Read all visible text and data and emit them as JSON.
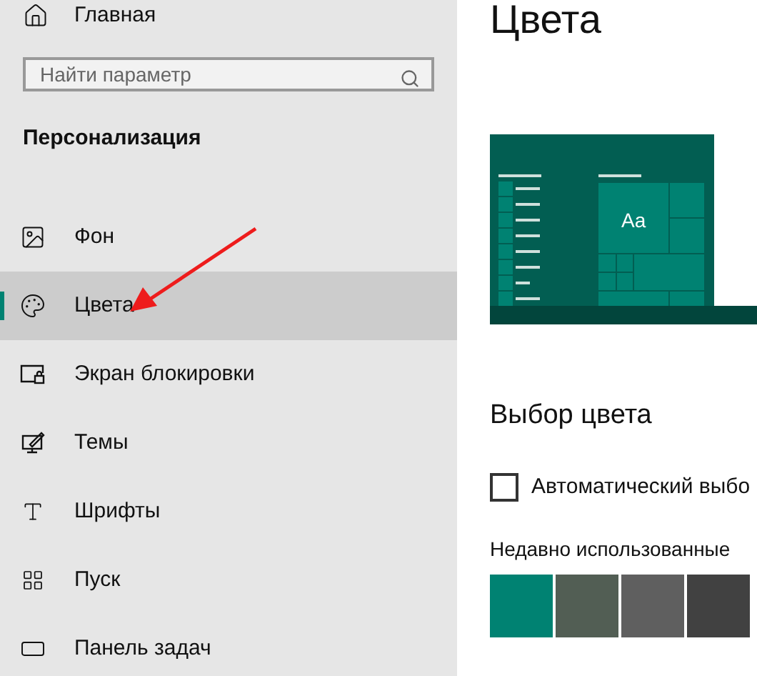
{
  "sidebar": {
    "home": "Главная",
    "search": {
      "placeholder": "Найти параметр"
    },
    "section": "Персонализация",
    "items": [
      {
        "label": "Фон",
        "selected": false
      },
      {
        "label": "Цвета",
        "selected": true
      },
      {
        "label": "Экран блокировки",
        "selected": false
      },
      {
        "label": "Темы",
        "selected": false
      },
      {
        "label": "Шрифты",
        "selected": false
      },
      {
        "label": "Пуск",
        "selected": false
      },
      {
        "label": "Панель задач",
        "selected": false
      }
    ]
  },
  "main": {
    "title": "Цвета",
    "preview_text": "Aa",
    "section": "Выбор цвета",
    "auto_checkbox": {
      "label": "Автоматический выбо",
      "checked": false
    },
    "recent_label": "Недавно использованные",
    "recent_colors": [
      {
        "color": "#008272"
      },
      {
        "color": "#525e54"
      },
      {
        "color": "#5f5f5f"
      },
      {
        "color": "#414141"
      }
    ]
  }
}
